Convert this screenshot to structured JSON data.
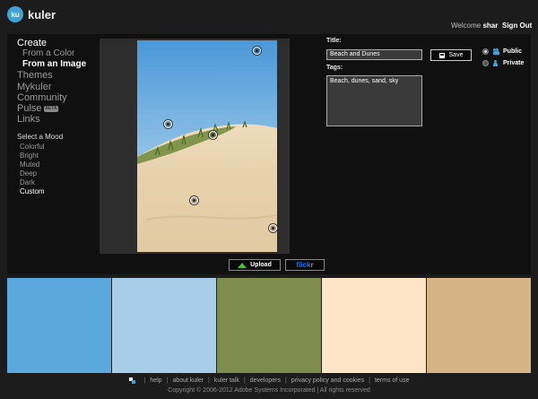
{
  "header": {
    "logo_badge": "ku",
    "app_name": "kuler",
    "welcome_text": "Welcome",
    "username": "shar",
    "sign_out_label": "Sign Out"
  },
  "nav": {
    "create": "Create",
    "from_color": "From a Color",
    "from_image": "From an Image",
    "themes": "Themes",
    "mykuler": "Mykuler",
    "community": "Community",
    "pulse": "Pulse",
    "pulse_badge": "BETA",
    "links": "Links"
  },
  "mood": {
    "heading": "Select a Mood",
    "options": [
      "Colorful",
      "Bright",
      "Muted",
      "Deep",
      "Dark",
      "Custom"
    ],
    "selected": "Custom"
  },
  "image_panel": {
    "upload_label": "Upload",
    "flickr_part1": "flick",
    "flickr_part2": "r"
  },
  "form": {
    "title_label": "Title:",
    "title_value": "Beach and Dunes",
    "tags_label": "Tags:",
    "tags_value": "Beach, dunes, sand, sky",
    "save_label": "Save",
    "public_label": "Public",
    "private_label": "Private",
    "visibility": "Public"
  },
  "swatches": [
    {
      "name": "sky-blue",
      "color": "#5ba9dc"
    },
    {
      "name": "light-blue",
      "color": "#a7cde8"
    },
    {
      "name": "olive-green",
      "color": "#7f8d4c"
    },
    {
      "name": "cream",
      "color": "#fde4c7"
    },
    {
      "name": "sand",
      "color": "#d5b585"
    }
  ],
  "footer": {
    "links": [
      "help",
      "about kuler",
      "kuler talk",
      "developers",
      "privacy policy and cookies",
      "terms of use"
    ],
    "copyright": "Copyright © 2006-2012 Adobe Systems Incorporated | All rights reserved"
  }
}
